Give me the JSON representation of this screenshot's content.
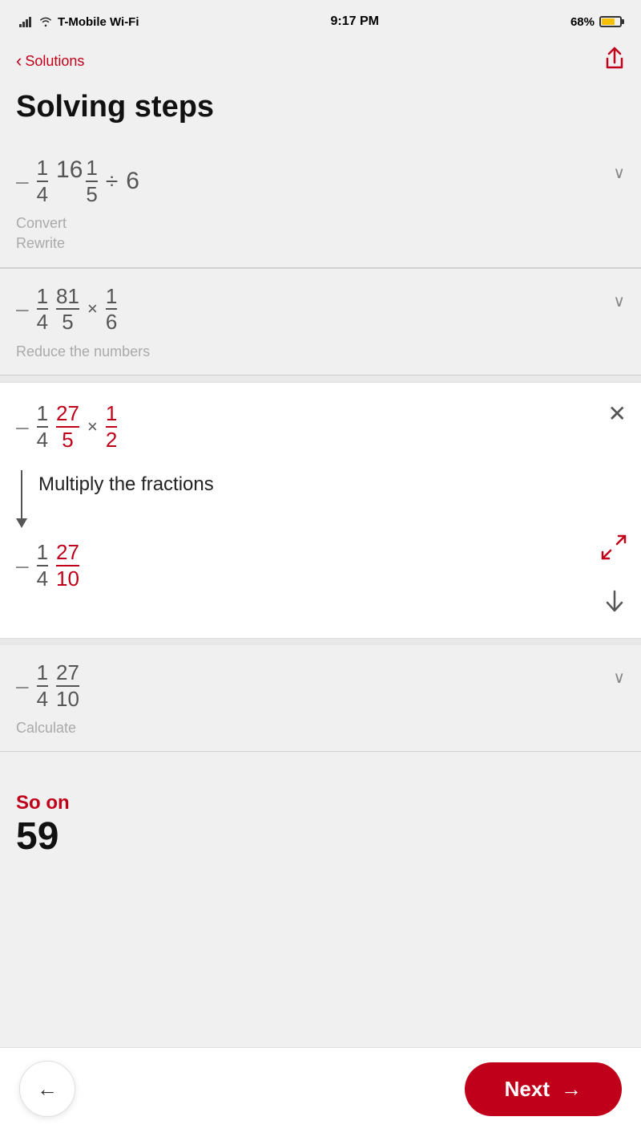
{
  "statusBar": {
    "carrier": "T-Mobile Wi-Fi",
    "time": "9:17 PM",
    "battery": "68%"
  },
  "nav": {
    "backLabel": "Solutions",
    "shareIcon": "share-icon"
  },
  "pageTitle": "Solving steps",
  "steps": [
    {
      "id": "step1",
      "collapsed": true,
      "expr": "-1/4 · 16 1/5 ÷ 6",
      "desc1": "Convert",
      "desc2": "Rewrite"
    },
    {
      "id": "step2",
      "collapsed": true,
      "expr": "-1/4 · 81/5 × 1/6",
      "desc": "Reduce the numbers"
    },
    {
      "id": "step3",
      "collapsed": false,
      "expr": "-1/4 · 27/5 × 1/2",
      "stepText": "Multiply the fractions",
      "resultExpr": "-1/4 · 27/10"
    },
    {
      "id": "step4",
      "collapsed": true,
      "expr": "-1/4 · 27/10",
      "desc": "Calculate"
    }
  ],
  "bottomSection": {
    "solutionLabel": "So  on",
    "solutionValue": "59"
  },
  "buttons": {
    "backLabel": "←",
    "nextLabel": "Next",
    "nextArrow": "→"
  }
}
